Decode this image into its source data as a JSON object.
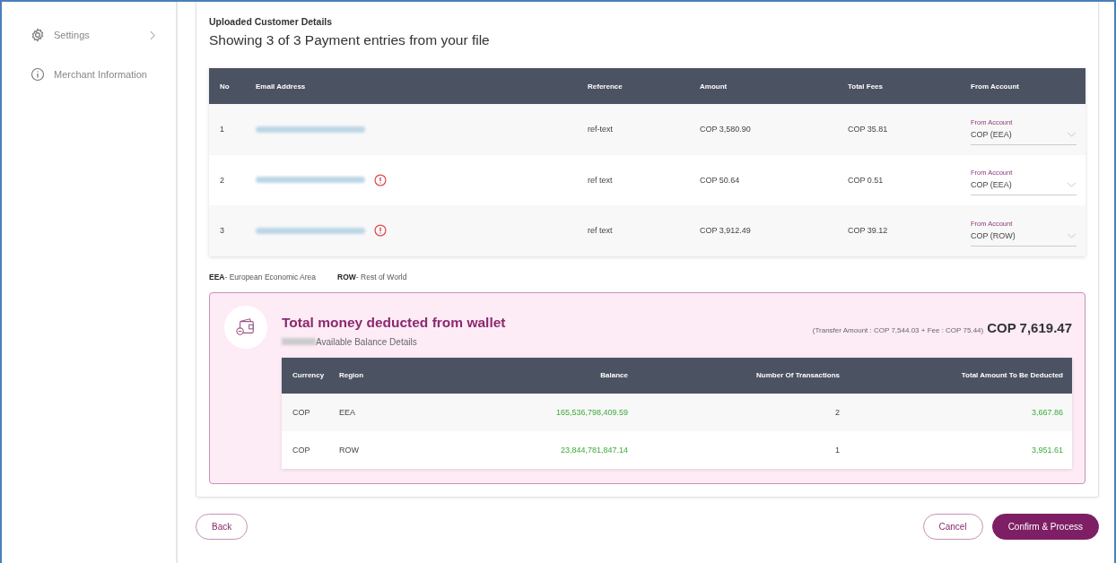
{
  "sidebar": {
    "items": [
      {
        "label": "Settings",
        "kind": "settings",
        "has_submenu": true
      },
      {
        "label": "Merchant Information",
        "kind": "info",
        "has_submenu": false
      }
    ]
  },
  "section": {
    "caption": "Uploaded Customer Details",
    "heading": "Showing 3 of 3 Payment entries from your file"
  },
  "payments": {
    "columns": [
      "No",
      "Email Address",
      "Reference",
      "Amount",
      "Total Fees",
      "From Account"
    ],
    "rows": [
      {
        "no": "1",
        "warning": false,
        "reference": "ref-text",
        "amount": "COP 3,580.90",
        "fees": "COP 35.81",
        "account_label": "From Account",
        "account": "COP (EEA)"
      },
      {
        "no": "2",
        "warning": true,
        "reference": "ref text",
        "amount": "COP 50.64",
        "fees": "COP 0.51",
        "account_label": "From Account",
        "account": "COP (EEA)"
      },
      {
        "no": "3",
        "warning": true,
        "reference": "ref text",
        "amount": "COP 3,912.49",
        "fees": "COP 39.12",
        "account_label": "From Account",
        "account": "COP (ROW)"
      }
    ]
  },
  "legend": [
    {
      "code": "EEA",
      "text": "- European Economic Area"
    },
    {
      "code": "ROW",
      "text": "- Rest of World"
    }
  ],
  "summary": {
    "title": "Total money deducted from wallet",
    "subtitle": "Available Balance Details",
    "breakdown": "(Transfer Amount : COP 7,544.03 + Fee : COP 75.44)",
    "total": "COP 7,619.47",
    "columns": [
      "Currency",
      "Region",
      "Balance",
      "Number Of Transactions",
      "Total Amount To Be Deducted"
    ],
    "rows": [
      {
        "currency": "COP",
        "region": "EEA",
        "balance": "165,536,798,409.59",
        "count": "2",
        "deducted": "3,667.86"
      },
      {
        "currency": "COP",
        "region": "ROW",
        "balance": "23,844,781,847.14",
        "count": "1",
        "deducted": "3,951.61"
      }
    ]
  },
  "buttons": {
    "back": "Back",
    "cancel": "Cancel",
    "confirm": "Confirm & Process"
  }
}
